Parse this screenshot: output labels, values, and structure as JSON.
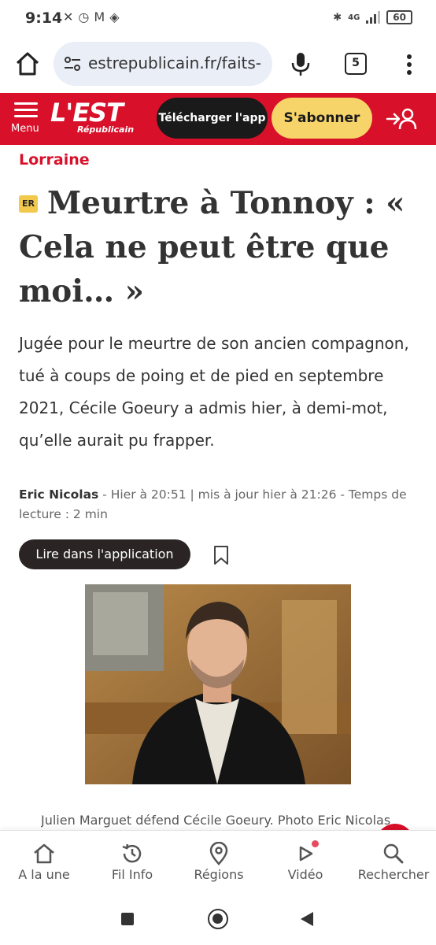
{
  "status": {
    "time": "9:14",
    "battery": "60",
    "network": "4G"
  },
  "browser": {
    "url": "estrepublicain.fr/faits-",
    "tab_count": "5"
  },
  "site_header": {
    "menu_label": "Menu",
    "logo_main": "L'EST",
    "logo_sub": "Républicain",
    "download_label": "Télécharger l'app",
    "subscribe_label": "S'abonner",
    "brand_red": "#d8102a",
    "subscribe_yellow": "#f7d46a"
  },
  "article": {
    "category": "Lorraine",
    "badge": "ER",
    "headline": "Meurtre à Tonnoy : « Cela ne peut être que moi… »",
    "lead": "Jugée pour le meurtre de son ancien compagnon, tué à coups de poing et de pied en septembre 2021, Cécile Goeury a admis hier, à demi-mot, qu’elle aurait pu frapper.",
    "author": "Eric Nicolas",
    "meta": " - Hier à 20:51 | mis à jour hier à 21:26 - Temps de lecture : 2 min",
    "app_button_label": "Lire dans l'application",
    "photo_caption": "Julien Marguet défend Cécile Goeury.  Photo Eric Nicolas"
  },
  "bottom_nav": {
    "items": [
      {
        "label": "A la une",
        "icon": "home-icon"
      },
      {
        "label": "Fil Info",
        "icon": "history-icon"
      },
      {
        "label": "Régions",
        "icon": "location-pin-icon"
      },
      {
        "label": "Vidéo",
        "icon": "play-icon"
      },
      {
        "label": "Rechercher",
        "icon": "search-icon"
      }
    ]
  }
}
